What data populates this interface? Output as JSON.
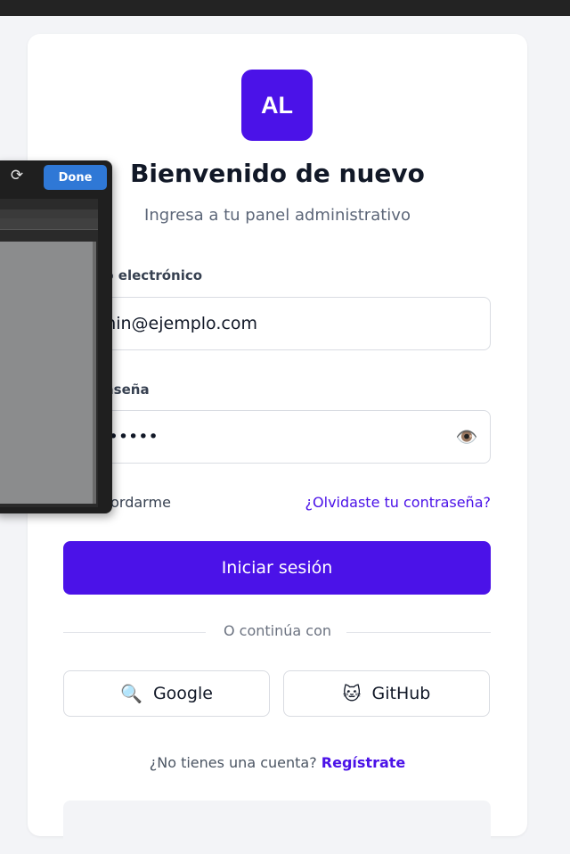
{
  "brand": {
    "initials": "AL",
    "color": "#4b12e8"
  },
  "header": {
    "title": "Bienvenido de nuevo",
    "subtitle": "Ingresa a tu panel administrativo"
  },
  "form": {
    "email_label": "Correo electrónico",
    "email_value": "admin@ejemplo.com",
    "password_label": "Contraseña",
    "password_value": "••••••••",
    "show_password_icon": "eye-icon",
    "remember_label": "Recordarme",
    "forgot_link": "¿Olvidaste tu contraseña?",
    "submit_label": "Iniciar sesión"
  },
  "social": {
    "divider_text": "O continúa con",
    "google_label": "Google",
    "google_icon": "🔍",
    "github_label": "GitHub",
    "github_icon": "🐱"
  },
  "signup": {
    "prompt": "¿No tienes una cuenta?",
    "link": "Regístrate"
  },
  "overlay": {
    "done_label": "Done",
    "refresh_icon": "refresh-icon"
  }
}
